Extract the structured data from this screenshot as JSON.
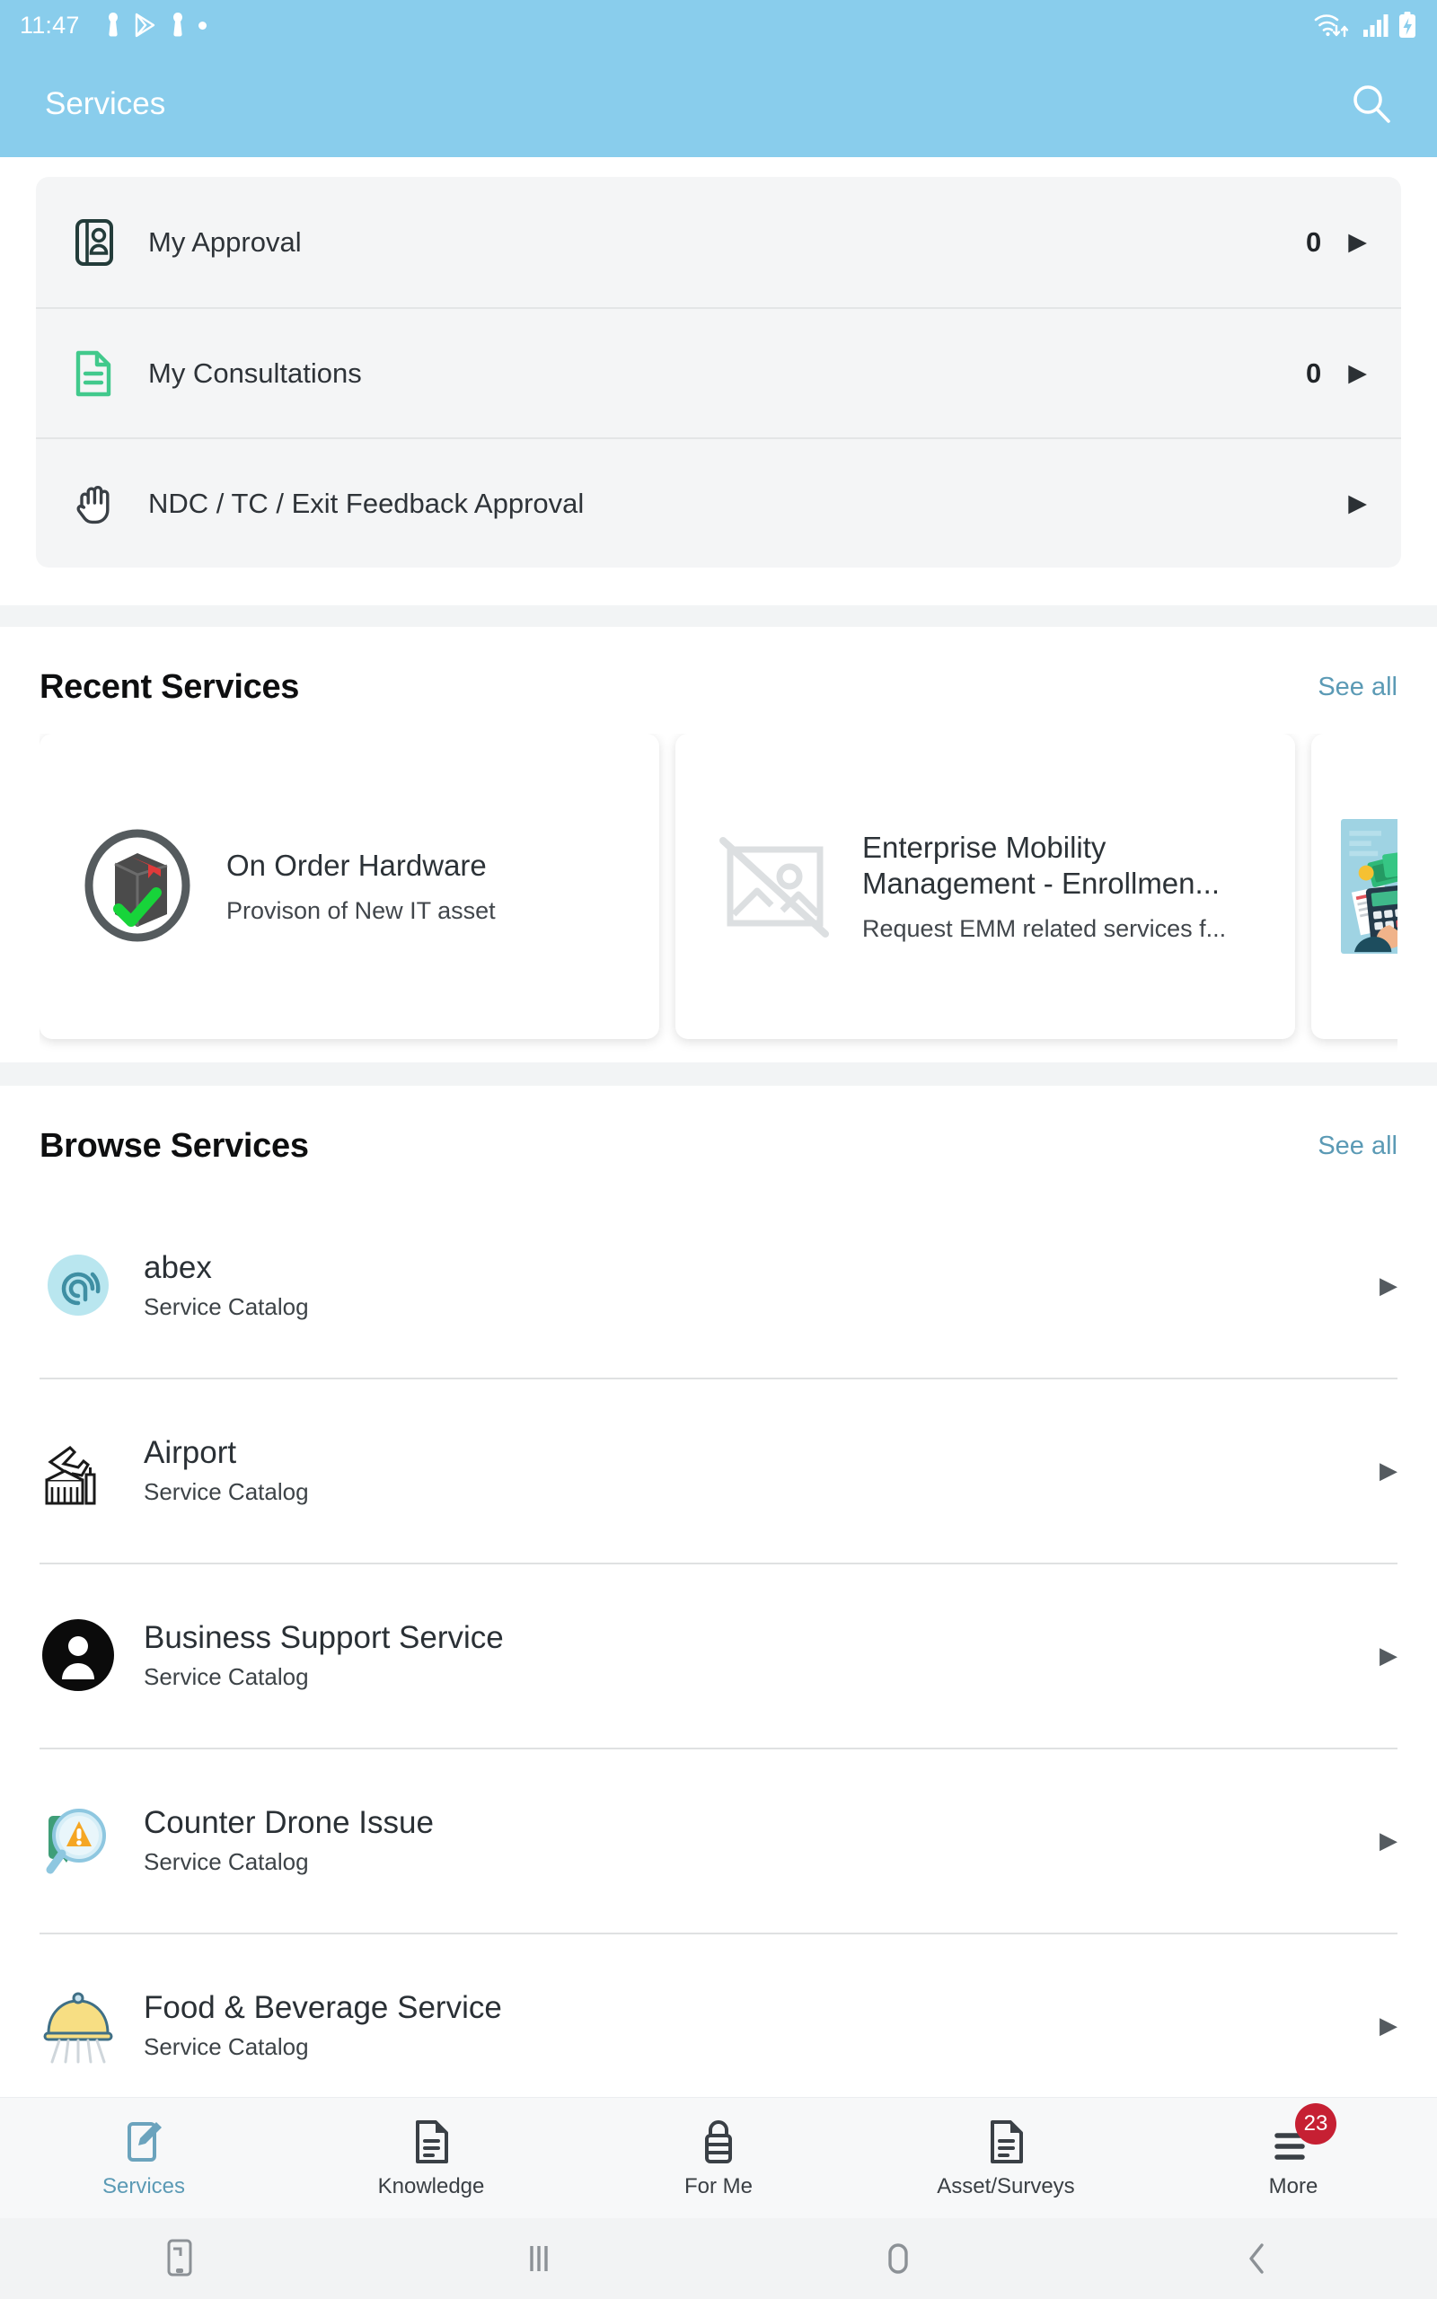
{
  "statusbar": {
    "time": "11:47",
    "left_icons": [
      "person-notification-icon",
      "play-store-icon",
      "person-notification-icon",
      "dot-icon"
    ],
    "right_icons": [
      "wifi-data-icon",
      "cellular-signal-icon",
      "battery-charging-icon"
    ]
  },
  "appbar": {
    "title": "Services",
    "search_icon": "search-icon"
  },
  "quick_actions": {
    "items": [
      {
        "label": "My Approval",
        "count": "0",
        "icon": "contact-book-icon",
        "caret": "▶"
      },
      {
        "label": "My Consultations",
        "count": "0",
        "icon": "document-icon",
        "caret": "▶"
      },
      {
        "label": "NDC / TC / Exit Feedback Approval",
        "count": "",
        "icon": "hand-palm-icon",
        "caret": "▶"
      }
    ]
  },
  "recent_services": {
    "title": "Recent Services",
    "see_all": "See all",
    "cards": [
      {
        "title": "On Order Hardware",
        "subtitle": "Provison of New IT asset",
        "icon": "package-approved-icon"
      },
      {
        "title": "Enterprise Mobility Management - Enrollmen...",
        "subtitle": "Request EMM related services f...",
        "icon": "broken-image-icon"
      },
      {
        "title": "",
        "subtitle": "",
        "icon": "asset-scrap-declaration-illustration"
      }
    ]
  },
  "browse_services": {
    "title": "Browse Services",
    "see_all": "See all",
    "items": [
      {
        "title": "abex",
        "subtitle": "Service Catalog",
        "icon": "abex-spiral-icon",
        "caret": "▶"
      },
      {
        "title": "Airport",
        "subtitle": "Service Catalog",
        "icon": "airplane-terminal-icon",
        "caret": "▶"
      },
      {
        "title": "Business Support Service",
        "subtitle": "Service Catalog",
        "icon": "person-circle-icon",
        "caret": "▶"
      },
      {
        "title": "Counter Drone Issue",
        "subtitle": "Service Catalog",
        "icon": "magnifier-warning-icon",
        "caret": "▶"
      },
      {
        "title": "Food & Beverage Service",
        "subtitle": "Service Catalog",
        "icon": "food-cloche-icon",
        "caret": "▶"
      }
    ]
  },
  "bottom_nav": {
    "items": [
      {
        "label": "Services",
        "icon": "edit-note-icon",
        "active": true,
        "badge": ""
      },
      {
        "label": "Knowledge",
        "icon": "document-icon",
        "active": false,
        "badge": ""
      },
      {
        "label": "For Me",
        "icon": "lock-document-icon",
        "active": false,
        "badge": ""
      },
      {
        "label": "Asset/Surveys",
        "icon": "document-lines-icon",
        "active": false,
        "badge": ""
      },
      {
        "label": "More",
        "icon": "hamburger-menu-icon",
        "active": false,
        "badge": "23"
      }
    ]
  },
  "system_nav": {
    "items": [
      "screenshot-icon",
      "recents-icon",
      "home-icon",
      "back-icon"
    ]
  },
  "colors": {
    "header": "#89cdec",
    "accent": "#5b9ab5",
    "badge": "#c62033",
    "card_bg": "#f4f5f6"
  }
}
